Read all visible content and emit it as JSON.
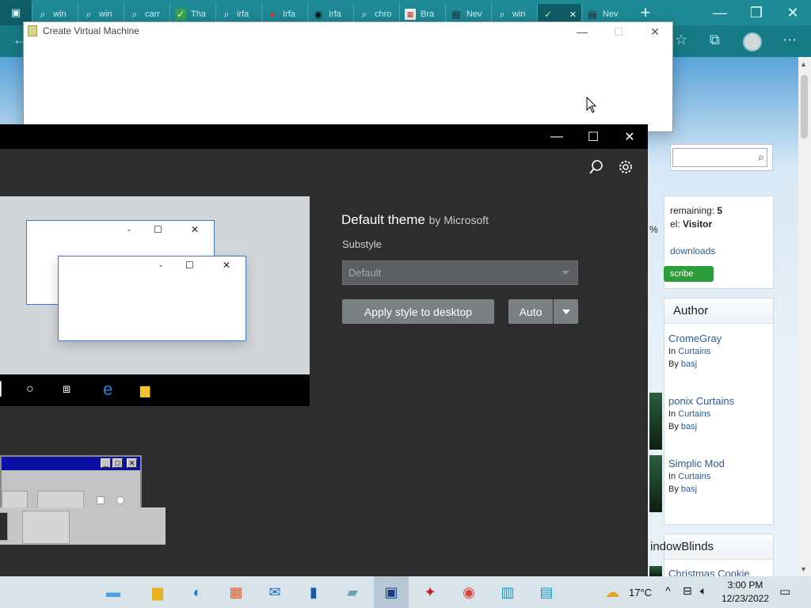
{
  "browser": {
    "tabs": [
      {
        "icon": "search-icon",
        "label": "win"
      },
      {
        "icon": "search-icon",
        "label": "win"
      },
      {
        "icon": "search-icon",
        "label": "carr"
      },
      {
        "icon": "check-icon",
        "label": "Tha"
      },
      {
        "icon": "search-icon",
        "label": "irfa"
      },
      {
        "icon": "irfanview-icon",
        "label": "Irfa"
      },
      {
        "icon": "github-icon",
        "label": "Irfa"
      },
      {
        "icon": "search-icon",
        "label": "chro"
      },
      {
        "icon": "image-icon",
        "label": "Bra"
      },
      {
        "icon": "newtab-icon",
        "label": "Nev"
      },
      {
        "icon": "search-icon",
        "label": "win"
      },
      {
        "icon": "wincustomize-icon",
        "label": ""
      },
      {
        "icon": "newtab-icon",
        "label": "Nev"
      }
    ],
    "new_tab": "+",
    "minimize": "—",
    "restore": "❐",
    "close": "✕"
  },
  "cvm_window": {
    "title": "Create Virtual Machine",
    "minimize": "—",
    "maximize": "☐",
    "close": "✕"
  },
  "wb_window": {
    "minimize": "—",
    "maximize": "☐",
    "close": "✕",
    "theme_name": "Default theme",
    "theme_by": "by Microsoft",
    "substyle_label": "Substyle",
    "substyle_value": "Default",
    "apply_button": "Apply style to desktop",
    "auto_button": "Auto",
    "preview_minimize": "-",
    "preview_maximize": "☐",
    "preview_close": "✕"
  },
  "web_sidebar": {
    "remaining_label": "remaining:",
    "remaining_value": "5",
    "level_label": "el:",
    "level_value": "Visitor",
    "downloads_link": "downloads",
    "subscribe_button": "scribe",
    "percent": "%",
    "author_heading": "Author",
    "items": [
      {
        "title": "CromeGray",
        "category_prefix": "In",
        "category": "Curtains",
        "author_prefix": "By",
        "author": "basj"
      },
      {
        "title": "ponix Curtains",
        "category_prefix": "In",
        "category": "Curtains",
        "author_prefix": "By",
        "author": "basj"
      },
      {
        "title": "Simplic Mod",
        "category_prefix": "In",
        "category": "Curtains",
        "author_prefix": "By",
        "author": "basj"
      }
    ],
    "windowblinds_heading": "indowBlinds",
    "christmas": "Christmas Cookie"
  },
  "taskbar": {
    "temperature": "17°C",
    "time": "3:00 PM",
    "date": "12/23/2022"
  },
  "colors": {
    "browser_teal": "#1d8a96",
    "wb_dark": "#2d2d2d",
    "button_gray": "#7b8083"
  }
}
